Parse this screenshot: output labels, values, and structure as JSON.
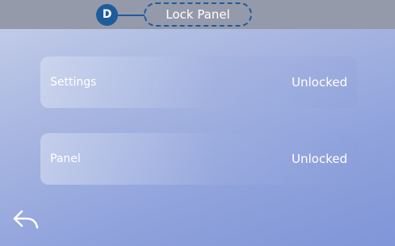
{
  "header": {
    "badge_letter": "D",
    "title": "Lock Panel"
  },
  "rows": [
    {
      "label": "Settings",
      "value": "Unlocked"
    },
    {
      "label": "Panel",
      "value": "Unlocked"
    }
  ],
  "icons": {
    "back": "back-arrow-icon"
  },
  "colors": {
    "badge": "#1f5c9c",
    "header_bar": "#949aaa",
    "text": "#ffffff"
  }
}
